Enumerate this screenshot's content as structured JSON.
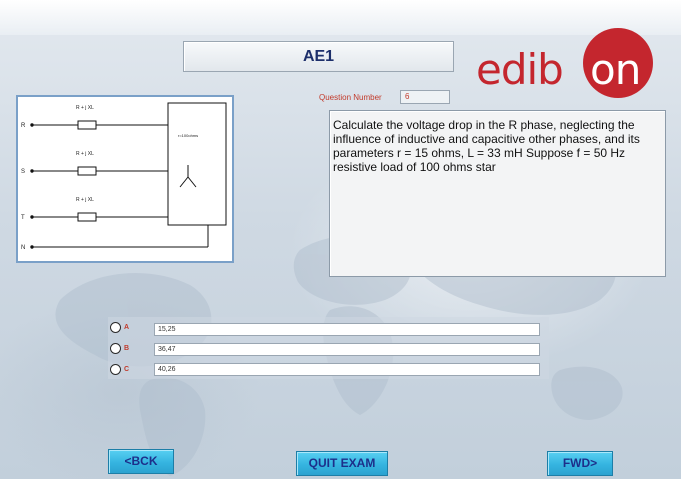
{
  "header": {
    "title": "AE1",
    "logo_text": "edibon"
  },
  "diagram": {
    "impedance_labels": [
      "R + j XL",
      "R + j XL",
      "R + j XL"
    ],
    "phase_labels": [
      "R",
      "S",
      "T",
      "N"
    ],
    "load_label": "r=100ohms"
  },
  "question": {
    "number_label": "Question Number",
    "number_value": "6",
    "text": "Calculate the voltage drop in the R phase, neglecting the influence of inductive and capacitive other phases, and its parameters r = 15 ohms, L = 33 mH Suppose f = 50 Hz resistive load of 100 ohms star"
  },
  "answers": [
    {
      "letter": "A",
      "value": "15,25"
    },
    {
      "letter": "B",
      "value": "36,47"
    },
    {
      "letter": "C",
      "value": "40,26"
    }
  ],
  "buttons": {
    "back_label": "<BCK",
    "quit_label": "QUIT EXAM",
    "forward_label": "FWD>"
  },
  "colors": {
    "brand_red": "#c4262e",
    "button_blue": "#35b4e0",
    "button_text": "#1d2f8a",
    "title_text": "#1d2f6b"
  }
}
